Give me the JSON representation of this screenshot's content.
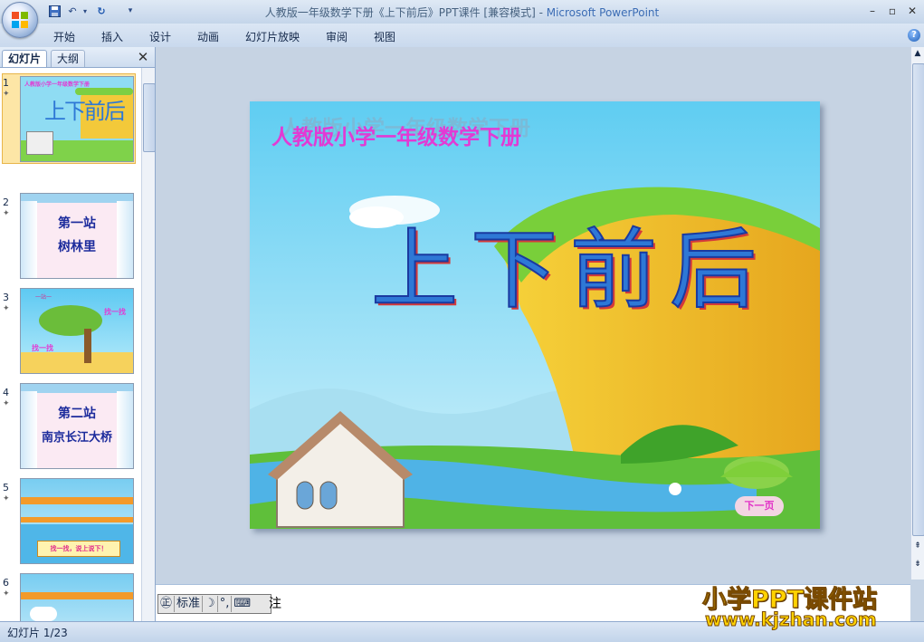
{
  "window": {
    "title_prefix": "人教版一年级数学下册《上下前后》PPT课件 [兼容模式] - ",
    "title_app": "Microsoft PowerPoint",
    "controls": [
      "–",
      "▫",
      "✕"
    ]
  },
  "quick_access": {
    "undo": "↶",
    "redo": "↻"
  },
  "ribbon": {
    "tabs": [
      "开始",
      "插入",
      "设计",
      "动画",
      "幻灯片放映",
      "审阅",
      "视图"
    ],
    "help": "?"
  },
  "left_pane": {
    "tabs": [
      "幻灯片",
      "大纲"
    ],
    "close": "✕",
    "slides": [
      {
        "num": "1",
        "title": "人教版小学一年级数学下册",
        "big": "上下前后"
      },
      {
        "num": "2",
        "line1": "第一站",
        "line2": "树林里"
      },
      {
        "num": "3",
        "tag1": "一站一",
        "tag2": "找一找",
        "tag3": "找一找"
      },
      {
        "num": "4",
        "line1": "第二站",
        "line2": "南京长江大桥"
      },
      {
        "num": "5",
        "banner": "找一找，说上说下！"
      },
      {
        "num": "6"
      }
    ]
  },
  "slide": {
    "subtitle": "人教版小学一年级数学下册",
    "chars": [
      "上",
      "下",
      "前",
      "后"
    ],
    "next_button": "下一页"
  },
  "notes": {
    "placeholder": "注",
    "ime": [
      "标准"
    ]
  },
  "status": {
    "text": "幻灯片 1/23"
  },
  "watermark": {
    "line1": "小学PPT课件站",
    "line2": "www.kjzhan.com"
  }
}
